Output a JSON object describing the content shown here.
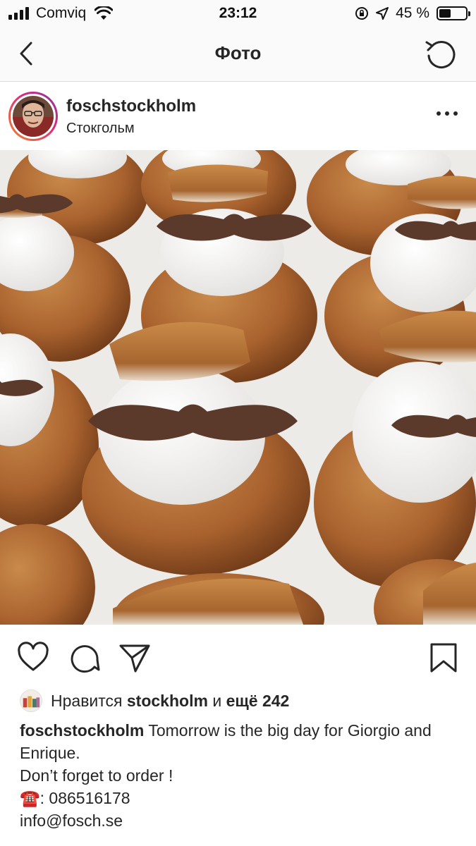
{
  "status_bar": {
    "carrier": "Comviq",
    "time": "23:12",
    "battery_text": "45 %",
    "battery_level": 0.45
  },
  "nav": {
    "title": "Фото",
    "back_icon": "chevron-left-icon",
    "refresh_icon": "refresh-icon"
  },
  "post": {
    "username": "foschstockholm",
    "location": "Стокгольм",
    "image_alt": "Semlor buns with cream and chocolate mustaches"
  },
  "actions": {
    "like_icon": "heart-icon",
    "comment_icon": "comment-icon",
    "share_icon": "share-icon",
    "save_icon": "bookmark-icon"
  },
  "likes": {
    "prefix": "Нравится",
    "user": "stockholm",
    "conjunction": "и",
    "others": "ещё 242"
  },
  "caption": {
    "username": "foschstockholm",
    "line1": "Tomorrow is the big day for Giorgio and Enrique.",
    "line2": "Don’t forget to order !",
    "phone_emoji": "☎️",
    "phone": ": 086516178",
    "email": "info@fosch.se"
  },
  "colors": {
    "bar_background": "#fafafa",
    "text": "#262626",
    "divider": "#dbdbdb"
  }
}
